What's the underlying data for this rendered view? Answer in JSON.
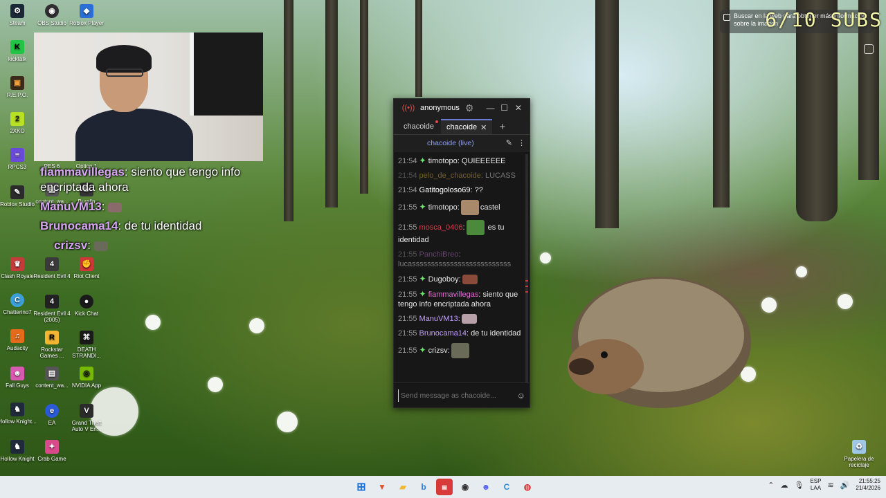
{
  "desktop_icons": [
    {
      "label": "Steam",
      "icon": "steam-icon",
      "color": "#1b2838"
    },
    {
      "label": "OBS Studio",
      "icon": "obs-icon",
      "color": "#302e31"
    },
    {
      "label": "Roblox Player",
      "icon": "roblox-icon",
      "color": "#2a6fd6"
    },
    {
      "label": "kicktalk",
      "icon": "kicktalk-icon",
      "color": "#21c445"
    },
    {
      "label": "R.E.P.O.",
      "icon": "repo-icon",
      "color": "#3a2b1a"
    },
    {
      "label": "2XKO",
      "icon": "2xko-icon",
      "color": "#b8e024"
    },
    {
      "label": "RPCS3",
      "icon": "rpcs3-icon",
      "color": "#6a4ad8"
    },
    {
      "label": "Roblox Studio",
      "icon": "roblox-studio-icon",
      "color": "#2b2b2b"
    },
    {
      "label": "Clash Royale",
      "icon": "clash-royale-icon",
      "color": "#c53a3a"
    },
    {
      "label": "Chatterino7",
      "icon": "chatterino-icon",
      "color": "#3aa0d8"
    },
    {
      "label": "Audacity",
      "icon": "audacity-icon",
      "color": "#e36b1b"
    },
    {
      "label": "Fall Guys",
      "icon": "fall-guys-icon",
      "color": "#d85ab0"
    },
    {
      "label": "Hollow Knight...",
      "icon": "hollow-knight-icon",
      "color": "#1f2a3a"
    },
    {
      "label": "Hollow Knight",
      "icon": "hollow-knight-icon",
      "color": "#1f2a3a"
    },
    {
      "label": "PES 6",
      "icon": "pes-icon",
      "color": "#2c4a8c"
    },
    {
      "label": "Option 1",
      "icon": "option-icon",
      "color": "#444444"
    },
    {
      "label": "content_wa...",
      "icon": "file-icon",
      "color": "#555555"
    },
    {
      "label": "Burglin",
      "icon": "burglin-icon",
      "color": "#333333"
    },
    {
      "label": "Resident Evil 4",
      "icon": "re4-icon",
      "color": "#3a3a3a"
    },
    {
      "label": "Riot Client",
      "icon": "riot-icon",
      "color": "#d13639"
    },
    {
      "label": "Resident Evil 4 (2005)",
      "icon": "re4-icon",
      "color": "#222222"
    },
    {
      "label": "Kick Chat",
      "icon": "kick-icon",
      "color": "#1a1a1a"
    },
    {
      "label": "Rockstar Games ...",
      "icon": "rockstar-icon",
      "color": "#f2b632"
    },
    {
      "label": "DEATH STRANDI...",
      "icon": "death-stranding-icon",
      "color": "#1a1a1a"
    },
    {
      "label": "content_wa...",
      "icon": "file-icon",
      "color": "#555555"
    },
    {
      "label": "NVIDIA App",
      "icon": "nvidia-icon",
      "color": "#76b900"
    },
    {
      "label": "EA",
      "icon": "ea-icon",
      "color": "#2a5ad8"
    },
    {
      "label": "Grand Theft Auto V En...",
      "icon": "gta-icon",
      "color": "#2b2b2b"
    },
    {
      "label": "Crab Game",
      "icon": "crab-game-icon",
      "color": "#d84a8a"
    },
    {
      "label": "Papelera de reciclaje",
      "icon": "recycle-bin-icon",
      "color": "#9fc8e8"
    }
  ],
  "overlay_chat": [
    {
      "user": "fiammavillegas",
      "text": ": siento que tengo info encriptada ahora",
      "color": "#d6a6f2"
    },
    {
      "user": "ManuVM13",
      "text": ":",
      "color": "#d6a6f2"
    },
    {
      "user": "Brunocama14",
      "text": ": de tu identidad",
      "color": "#d6a6f2"
    },
    {
      "user": "crizsv",
      "text": ":",
      "color": "#d6a6f2"
    }
  ],
  "subs_counter": "6/10 SUBS",
  "lens_tooltip": "Buscar en la web para obtener más información sobre la imagen",
  "chat": {
    "account": "anonymous",
    "tabs": [
      {
        "label": "chacoide",
        "active": false
      },
      {
        "label": "chacoide",
        "active": true
      }
    ],
    "channel_header": "chacoide (live)",
    "messages": [
      {
        "time": "21:54",
        "user": "timotopo",
        "user_color": "#e6e6e6",
        "badge": true,
        "text": ": QUIEEEEEE",
        "dim": false
      },
      {
        "time": "21:54",
        "user": "pelo_de_chacoide",
        "user_color": "#e6b93b",
        "badge": false,
        "text": ": LUCASS",
        "dim": true
      },
      {
        "time": "21:54",
        "user": "Gatitogoloso69",
        "user_color": "#ffffff",
        "badge": false,
        "text": ": ??",
        "dim": false
      },
      {
        "time": "21:55",
        "user": "timotopo",
        "user_color": "#e6e6e6",
        "badge": true,
        "text": ": castel",
        "dim": false,
        "emote": "emote-castel"
      },
      {
        "time": "21:55",
        "user": "mosca_0406",
        "user_color": "#e0384a",
        "badge": false,
        "text": ": es tu identidad",
        "dim": false,
        "emote": "emote-pepe"
      },
      {
        "time": "21:55",
        "user": "PanchiBreo",
        "user_color": "#c07ad0",
        "badge": false,
        "text": ": lucassssssssssssssssssssssssss",
        "dim": true
      },
      {
        "time": "21:55",
        "user": "Dugoboy",
        "user_color": "#e6e6e6",
        "badge": true,
        "text": ":",
        "dim": false,
        "emote": "emote-car"
      },
      {
        "time": "21:55",
        "user": "fiammavillegas",
        "user_color": "#e76fd2",
        "badge": true,
        "text": ": siento que tengo info encriptada ahora",
        "dim": false
      },
      {
        "time": "21:55",
        "user": "ManuVM13",
        "user_color": "#c3a0ff",
        "badge": false,
        "text": ":",
        "dim": false,
        "emote": "emote-cat"
      },
      {
        "time": "21:55",
        "user": "Brunocama14",
        "user_color": "#c3a0ff",
        "badge": false,
        "text": ": de tu identidad",
        "dim": false
      },
      {
        "time": "21:55",
        "user": "crizsv",
        "user_color": "#e6e6e6",
        "badge": true,
        "text": ":",
        "dim": false,
        "emote": "emote-face"
      }
    ],
    "input_placeholder": "Send message as chacoide..."
  },
  "taskbar": {
    "lang_line1": "ESP",
    "lang_line2": "LAA",
    "time": "21:55:25",
    "date": "21/4/2026"
  }
}
